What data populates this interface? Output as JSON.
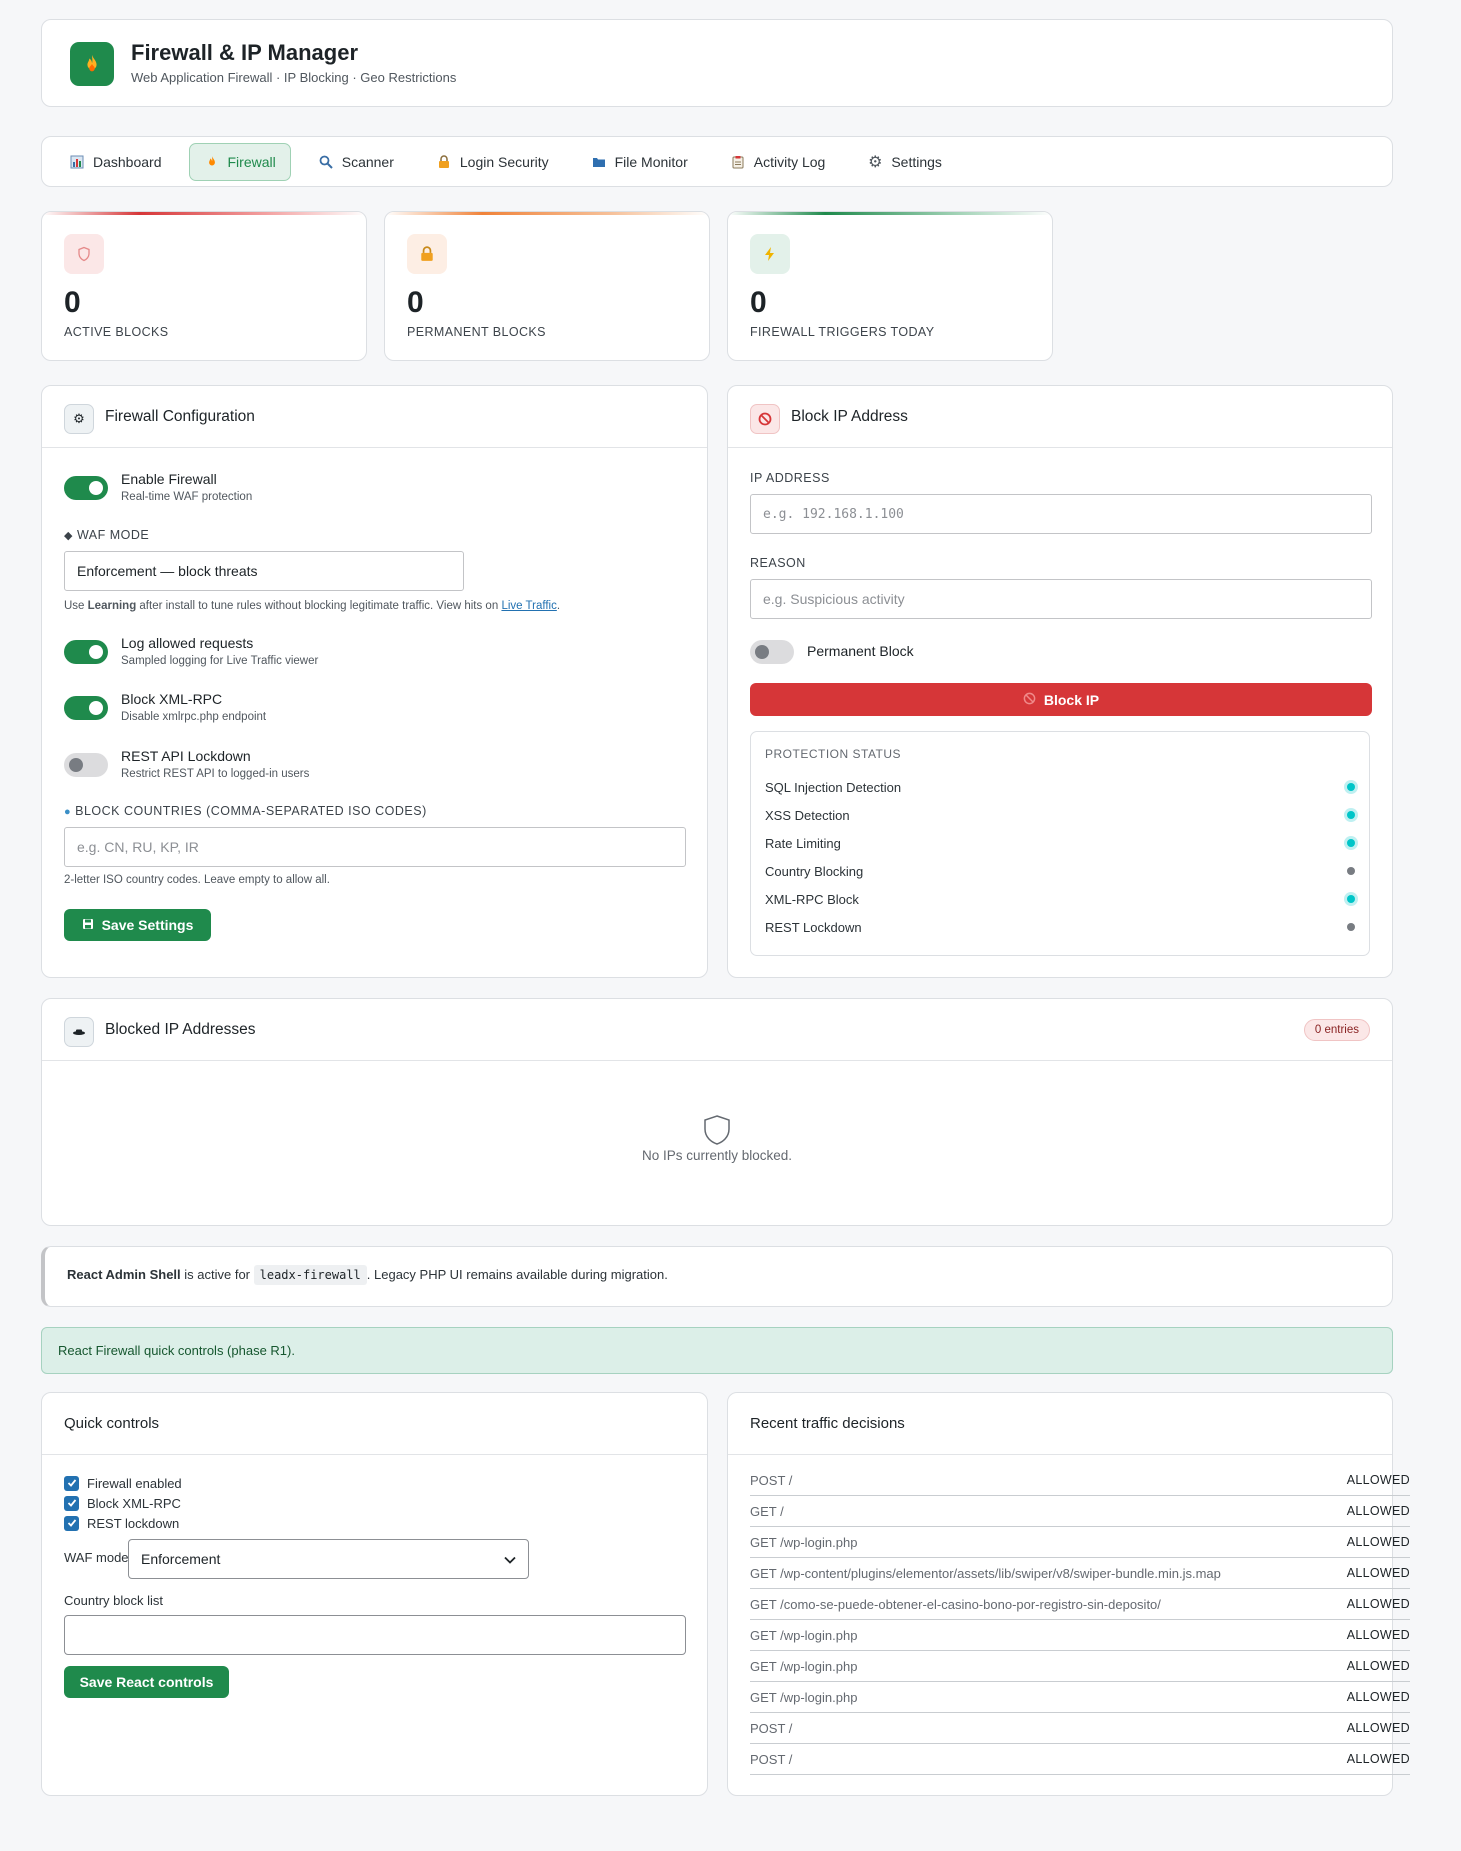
{
  "header": {
    "title": "Firewall & IP Manager",
    "subtitle": "Web Application Firewall · IP Blocking · Geo Restrictions",
    "logo_icon": "fire-icon",
    "brand_color": "#1f8a4c"
  },
  "tabs": [
    {
      "label": "Dashboard",
      "icon": "chart-icon"
    },
    {
      "label": "Firewall",
      "icon": "fire-icon",
      "active": true
    },
    {
      "label": "Scanner",
      "icon": "search-icon"
    },
    {
      "label": "Login Security",
      "icon": "lock-icon"
    },
    {
      "label": "File Monitor",
      "icon": "folder-icon"
    },
    {
      "label": "Activity Log",
      "icon": "clipboard-icon"
    },
    {
      "label": "Settings",
      "icon": "gear-icon"
    }
  ],
  "stats": [
    {
      "value": "0",
      "label": "ACTIVE BLOCKS",
      "icon": "shield-icon",
      "accent": "#d63638"
    },
    {
      "value": "0",
      "label": "PERMANENT BLOCKS",
      "icon": "lock-icon",
      "accent": "#f0833a"
    },
    {
      "value": "0",
      "label": "FIREWALL TRIGGERS TODAY",
      "icon": "bolt-icon",
      "accent": "#1f8a4c"
    }
  ],
  "config": {
    "title": "Firewall Configuration",
    "enable": {
      "title": "Enable Firewall",
      "desc": "Real-time WAF protection",
      "on": true
    },
    "waf_label": "WAF MODE",
    "waf_value": "Enforcement — block threats",
    "waf_help_pre": "Use ",
    "waf_help_bold": "Learning",
    "waf_help_mid": " after install to tune rules without blocking legitimate traffic. View hits on ",
    "waf_help_link": "Live Traffic",
    "waf_help_post": ".",
    "log": {
      "title": "Log allowed requests",
      "desc": "Sampled logging for Live Traffic viewer",
      "on": true
    },
    "xmlrpc": {
      "title": "Block XML-RPC",
      "desc": "Disable xmlrpc.php endpoint",
      "on": true
    },
    "rest": {
      "title": "REST API Lockdown",
      "desc": "Restrict REST API to logged-in users",
      "on": false
    },
    "countries_label": "BLOCK COUNTRIES (COMMA-SEPARATED ISO CODES)",
    "countries_placeholder": "e.g. CN, RU, KP, IR",
    "countries_help": "2-letter ISO country codes. Leave empty to allow all.",
    "save_label": "Save Settings"
  },
  "block_ip": {
    "title": "Block IP Address",
    "ip_label": "IP ADDRESS",
    "ip_placeholder": "e.g. 192.168.1.100",
    "reason_label": "REASON",
    "reason_placeholder": "e.g. Suspicious activity",
    "permanent_label": "Permanent Block",
    "permanent_on": false,
    "button_label": "Block IP",
    "protection_title": "PROTECTION STATUS",
    "protection": [
      {
        "name": "SQL Injection Detection",
        "active": true
      },
      {
        "name": "XSS Detection",
        "active": true
      },
      {
        "name": "Rate Limiting",
        "active": true
      },
      {
        "name": "Country Blocking",
        "active": false
      },
      {
        "name": "XML-RPC Block",
        "active": true
      },
      {
        "name": "REST Lockdown",
        "active": false
      }
    ]
  },
  "blocked": {
    "title": "Blocked IP Addresses",
    "badge": "0 entries",
    "empty": "No IPs currently blocked."
  },
  "shell_notice": {
    "bold": "React Admin Shell",
    "pre": " is active for ",
    "code": "leadx-firewall",
    "post": ". Legacy PHP UI remains available during migration."
  },
  "react_notice": "React Firewall quick controls (phase R1).",
  "quick": {
    "title": "Quick controls",
    "checks": [
      {
        "label": "Firewall enabled",
        "checked": true
      },
      {
        "label": "Block XML-RPC",
        "checked": true
      },
      {
        "label": "REST lockdown",
        "checked": true
      }
    ],
    "waf_label": "WAF mode",
    "waf_value": "Enforcement",
    "country_label": "Country block list",
    "country_value": "",
    "save_label": "Save React controls"
  },
  "traffic": {
    "title": "Recent traffic decisions",
    "rows": [
      {
        "req": "POST /",
        "decision": "ALLOWED"
      },
      {
        "req": "GET /",
        "decision": "ALLOWED"
      },
      {
        "req": "GET /wp-login.php",
        "decision": "ALLOWED"
      },
      {
        "req": "GET /wp-content/plugins/elementor/assets/lib/swiper/v8/swiper-bundle.min.js.map",
        "decision": "ALLOWED"
      },
      {
        "req": "GET /como-se-puede-obtener-el-casino-bono-por-registro-sin-deposito/",
        "decision": "ALLOWED"
      },
      {
        "req": "GET /wp-login.php",
        "decision": "ALLOWED"
      },
      {
        "req": "GET /wp-login.php",
        "decision": "ALLOWED"
      },
      {
        "req": "GET /wp-login.php",
        "decision": "ALLOWED"
      },
      {
        "req": "POST /",
        "decision": "ALLOWED"
      },
      {
        "req": "POST /",
        "decision": "ALLOWED"
      }
    ]
  }
}
